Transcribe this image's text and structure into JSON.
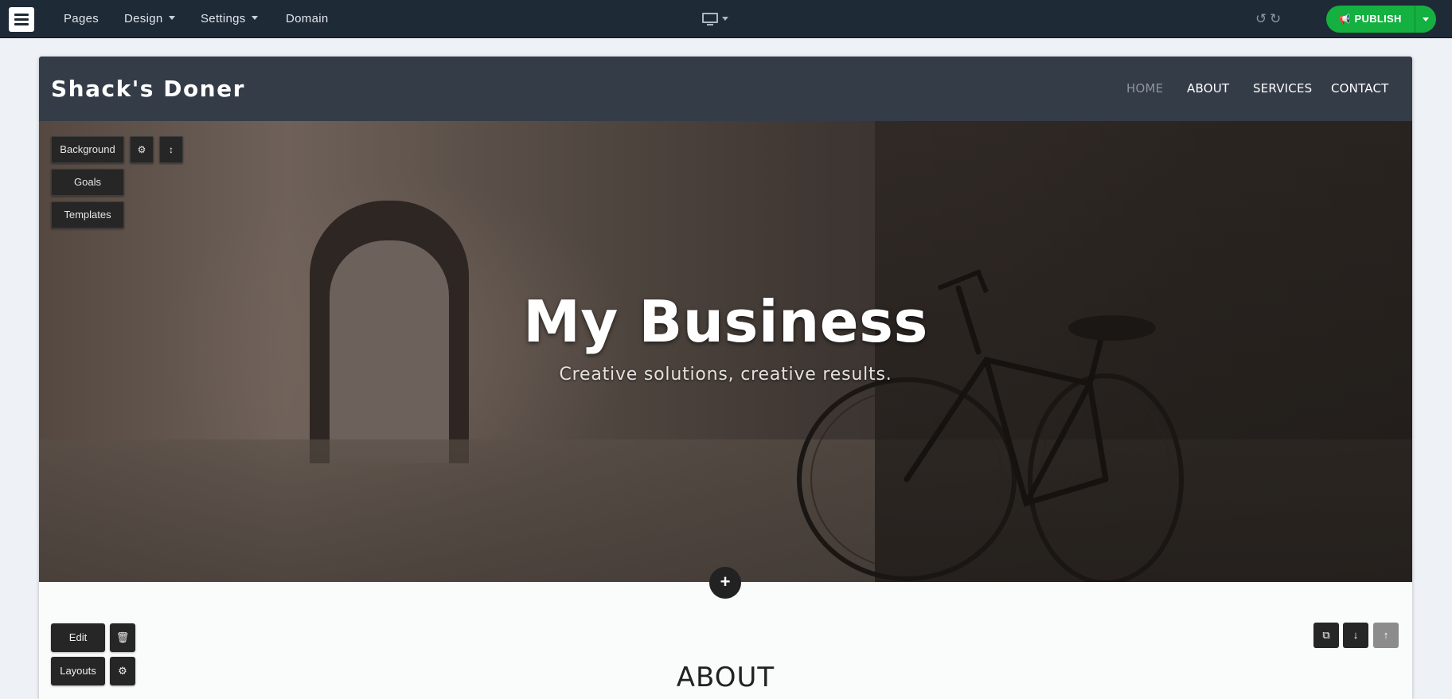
{
  "editor": {
    "menu": [
      {
        "label": "Pages",
        "dropdown": false
      },
      {
        "label": "Design",
        "dropdown": true
      },
      {
        "label": "Settings",
        "dropdown": true
      },
      {
        "label": "Domain",
        "dropdown": false
      }
    ],
    "device_icon": "desktop-monitor-icon",
    "publish_label": "PUBLISH",
    "publish_color": "#14b040"
  },
  "site": {
    "brand": "Shack's Doner",
    "nav": [
      "HOME",
      "ABOUT",
      "SERVICES",
      "CONTACT"
    ],
    "active_nav": "HOME",
    "hero": {
      "title": "My Business",
      "subtitle": "Creative solutions, creative results.",
      "tools": [
        "Background",
        "Goals",
        "Templates"
      ]
    },
    "section_tools": {
      "edit_label": "Edit",
      "layouts_label": "Layouts"
    },
    "about": {
      "title": "ABOUT"
    }
  }
}
